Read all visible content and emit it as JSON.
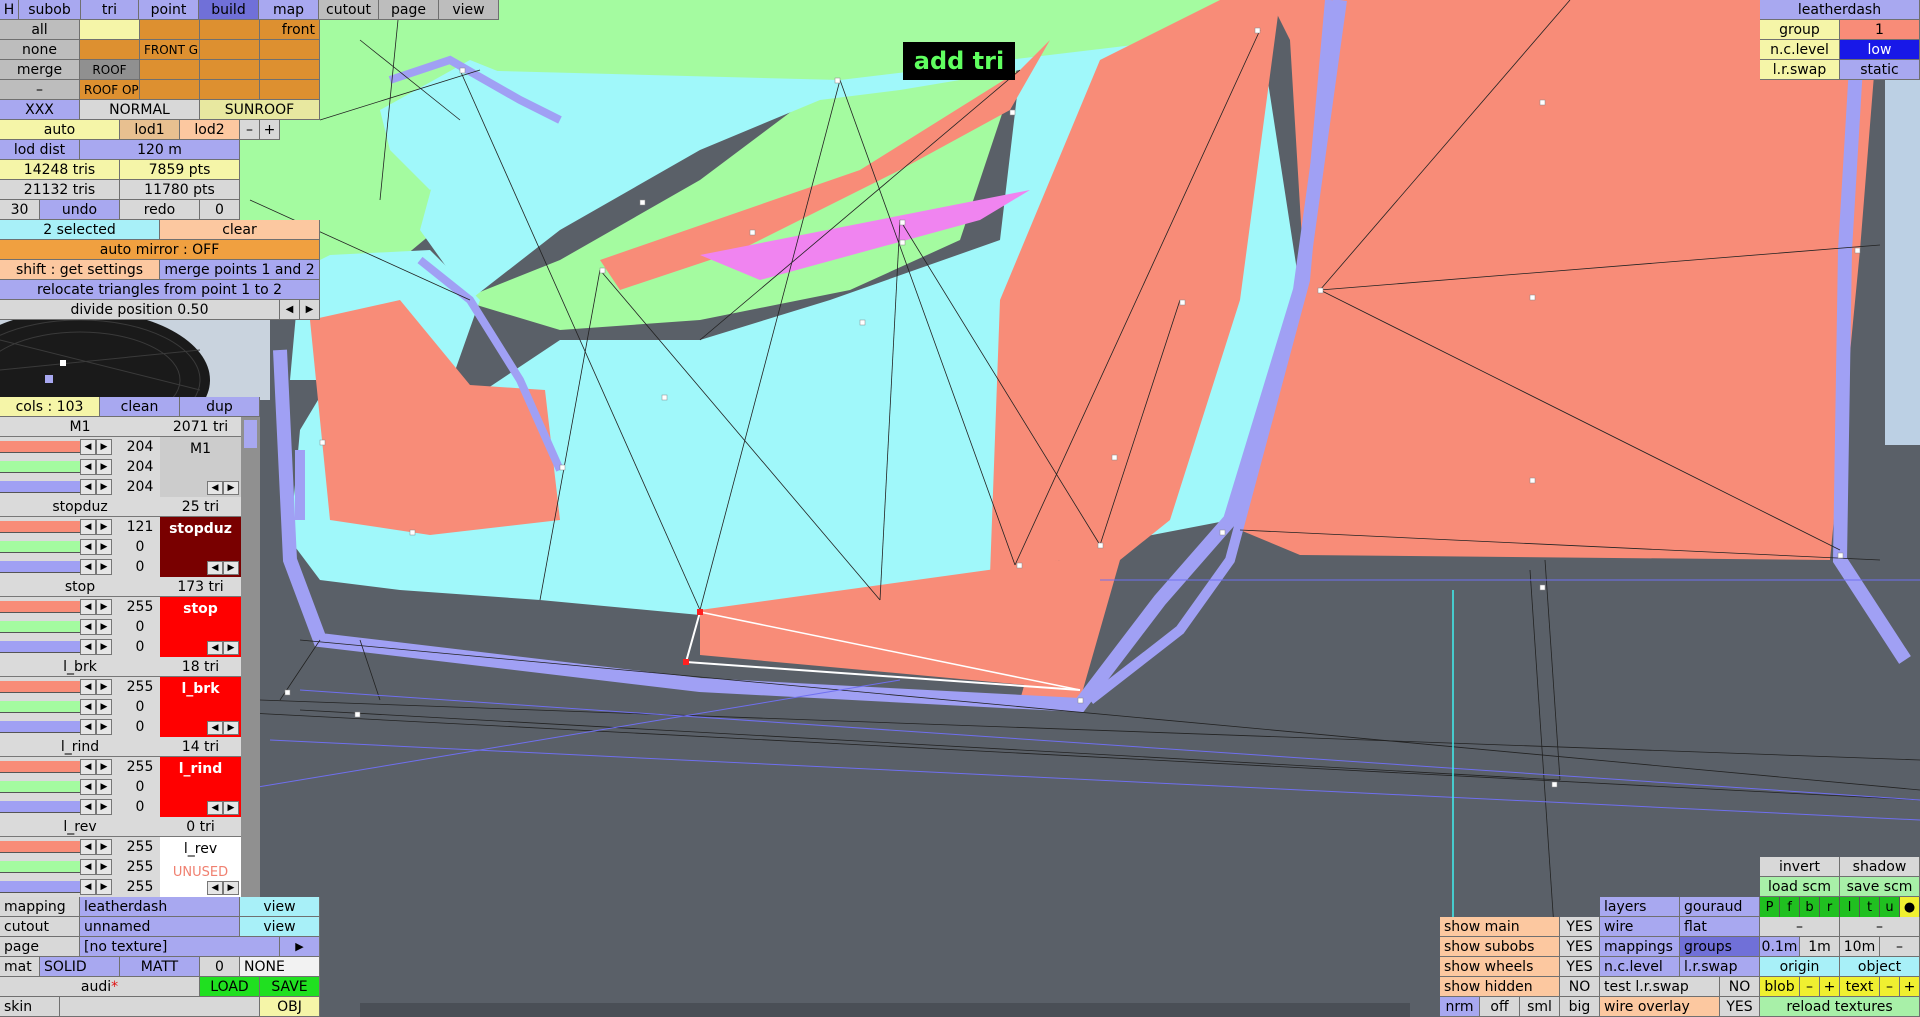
{
  "app": {
    "title_top": "add tri"
  },
  "toptabs": [
    "H",
    "subob",
    "tri",
    "point",
    "build",
    "map",
    "cutout",
    "page",
    "view"
  ],
  "rows": {
    "all": "all",
    "none": "none",
    "merge": "merge",
    "dash": "–",
    "front": "front",
    "front_g": "FRONT G",
    "roof": "ROOF",
    "roof_op": "ROOF OP",
    "xxx": "XXX",
    "normal": "NORMAL",
    "sunroof": "SUNROOF",
    "auto": "auto",
    "lod1": "lod1",
    "lod2": "lod2",
    "minus": "–",
    "plus": "+",
    "lod_dist": "lod dist",
    "lod_dist_val": "120 m",
    "tris1": "14248 tris",
    "pts1": "7859 pts",
    "tris2": "21132 tris",
    "pts2": "11780 pts",
    "undo_count": "30",
    "undo": "undo",
    "redo": "redo",
    "redo_count": "0",
    "selected": "2 selected",
    "clear": "clear",
    "auto_mirror": "auto mirror : OFF",
    "shift_get": "shift : get settings",
    "merge_points": "merge points 1 and 2",
    "relocate": "relocate triangles from point 1 to 2",
    "divide": "divide position 0.50"
  },
  "cols": {
    "header": "cols : 103",
    "clean": "clean",
    "dup": "dup"
  },
  "materials": [
    {
      "name": "M1",
      "tris": "2071 tri",
      "r": "204",
      "g": "204",
      "b": "204",
      "swatch": "M1",
      "color": "#cccccc",
      "text": "#000000",
      "unused": ""
    },
    {
      "name": "stopduz",
      "tris": "25 tri",
      "r": "121",
      "g": "0",
      "b": "0",
      "swatch": "stopduz",
      "color": "#790000",
      "text": "#ffffff",
      "unused": ""
    },
    {
      "name": "stop",
      "tris": "173 tri",
      "r": "255",
      "g": "0",
      "b": "0",
      "swatch": "stop",
      "color": "#ff0000",
      "text": "#ffffff",
      "unused": ""
    },
    {
      "name": "l_brk",
      "tris": "18 tri",
      "r": "255",
      "g": "0",
      "b": "0",
      "swatch": "l_brk",
      "color": "#ff0000",
      "text": "#ffffff",
      "unused": ""
    },
    {
      "name": "l_rind",
      "tris": "14 tri",
      "r": "255",
      "g": "0",
      "b": "0",
      "swatch": "l_rind",
      "color": "#ff0000",
      "text": "#ffffff",
      "unused": ""
    },
    {
      "name": "l_rev",
      "tris": "0 tri",
      "r": "255",
      "g": "255",
      "b": "255",
      "swatch": "l_rev",
      "color": "#ffffff",
      "text": "#000000",
      "unused": "UNUSED"
    }
  ],
  "bottom_left": {
    "mapping": "mapping",
    "mapping_val": "leatherdash",
    "view": "view",
    "cutout": "cutout",
    "cutout_val": "unnamed",
    "page": "page",
    "page_val": "[no texture]",
    "page_arrow": "▶",
    "mat": "mat",
    "solid": "SOLID",
    "matt": "MATT",
    "mat_num": "0",
    "none": "NONE",
    "audi": "audi",
    "asterisk": "*",
    "load": "LOAD",
    "save": "SAVE",
    "skin": "skin",
    "obj": "OBJ"
  },
  "top_right": {
    "title": "leatherdash",
    "group": "group",
    "group_val": "1",
    "nc_level": "n.c.level",
    "nc_val": "low",
    "lr_swap": "l.r.swap",
    "lr_val": "static"
  },
  "bottom_right": {
    "show_main": "show main",
    "show_subobs": "show subobs",
    "show_wheels": "show wheels",
    "show_hidden": "show hidden",
    "yes": "YES",
    "no": "NO",
    "nrm": "nrm",
    "off": "off",
    "sml": "sml",
    "big": "big",
    "layers": "layers",
    "gouraud": "gouraud",
    "wire": "wire",
    "flat": "flat",
    "mappings": "mappings",
    "groups": "groups",
    "nc_level": "n.c.level",
    "lr_swap": "l.r.swap",
    "test_lr_swap": "test l.r.swap",
    "wire_overlay": "wire overlay",
    "invert": "invert",
    "shadow": "shadow",
    "load_scm": "load scm",
    "save_scm": "save scm",
    "pfbrltu": [
      "P",
      "f",
      "b",
      "r",
      "l",
      "t",
      "u",
      "●"
    ],
    "d01": "0.1m",
    "d1": "1m",
    "d10": "10m",
    "dash": "–",
    "origin": "origin",
    "object": "object",
    "blob": "blob",
    "text": "text",
    "minus": "–",
    "plus": "+",
    "reload": "reload textures"
  },
  "colors": {
    "cyan": "#a0f8fa",
    "salmon": "#f88c78",
    "green": "#a4fba0",
    "blue": "#a0a0f4",
    "pink": "#f084f0",
    "ground": "#5a6068",
    "sky": "#c8dcf0"
  }
}
